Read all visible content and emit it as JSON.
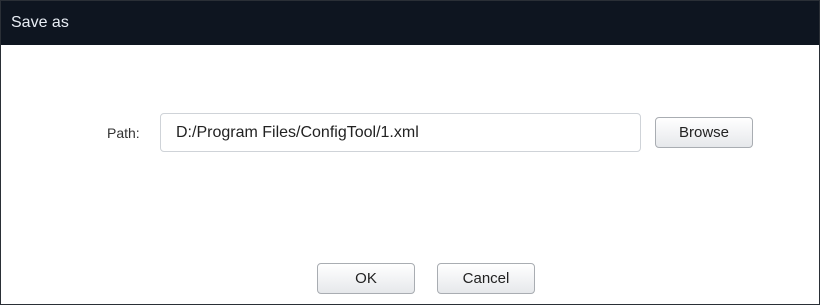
{
  "dialog": {
    "title": "Save as",
    "path_label": "Path:",
    "path_value": "D:/Program Files/ConfigTool/1.xml",
    "browse_label": "Browse",
    "ok_label": "OK",
    "cancel_label": "Cancel"
  },
  "colors": {
    "title_bar": "#0e1520",
    "title_text": "#e9eef5",
    "dialog_background": "#ffffff"
  }
}
